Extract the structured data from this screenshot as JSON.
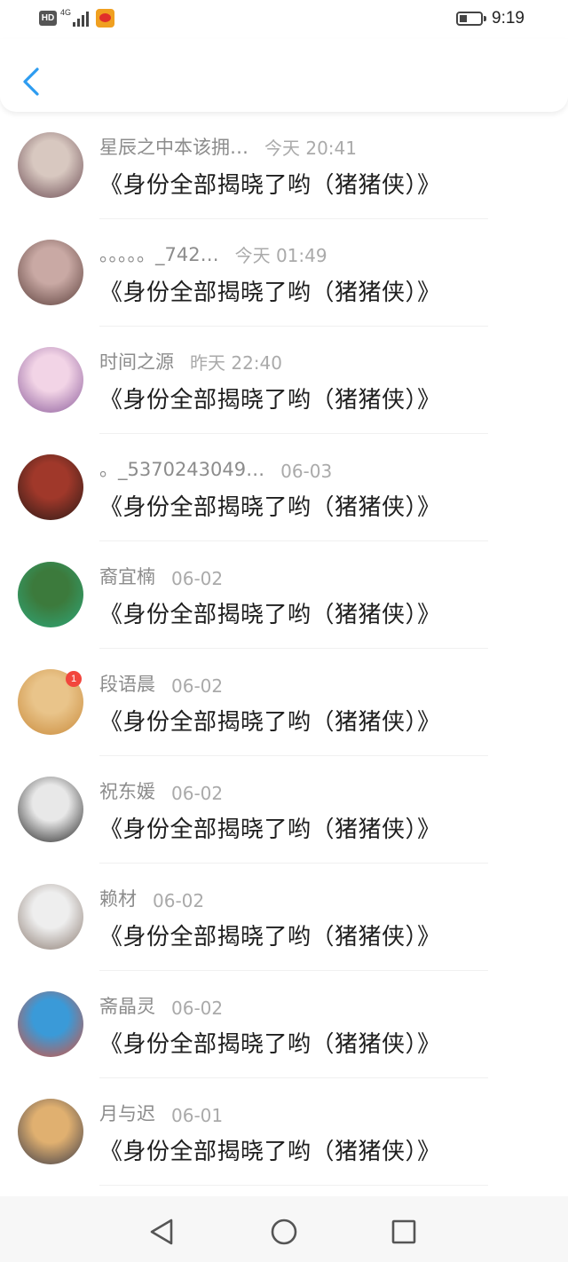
{
  "status_bar": {
    "hd": "HD",
    "network": "4G",
    "time": "9:19",
    "battery_level": 0.35
  },
  "header": {
    "back_icon": "chevron-left-icon",
    "accent": "#2d9cf0"
  },
  "items": [
    {
      "name": "星辰之中本该拥…",
      "time": "今天 20:41",
      "title": "《身份全部揭晓了哟（猪猪侠）》",
      "avatar_colors": [
        "#d8c8c0",
        "#6a4a52"
      ]
    },
    {
      "name": "。。。。。_742…",
      "time": "今天 01:49",
      "title": "《身份全部揭晓了哟（猪猪侠）》",
      "avatar_colors": [
        "#c9a9a4",
        "#5a3e3a"
      ]
    },
    {
      "name": "时间之源",
      "time": "昨天 22:40",
      "title": "《身份全部揭晓了哟（猪猪侠）》",
      "avatar_colors": [
        "#f2d4e6",
        "#8a5a9a"
      ]
    },
    {
      "name": "。_5370243049…",
      "time": "06-03",
      "title": "《身份全部揭晓了哟（猪猪侠）》",
      "avatar_colors": [
        "#a0382a",
        "#2a1a16"
      ]
    },
    {
      "name": "裔宜楠",
      "time": "06-02",
      "title": "《身份全部揭晓了哟（猪猪侠）》",
      "avatar_colors": [
        "#3c7a3c",
        "#2fa87a"
      ]
    },
    {
      "name": "段语晨",
      "time": "06-02",
      "title": "《身份全部揭晓了哟（猪猪侠）》",
      "avatar_colors": [
        "#e9c48a",
        "#c98a3a"
      ],
      "badge": "1"
    },
    {
      "name": "祝东媛",
      "time": "06-02",
      "title": "《身份全部揭晓了哟（猪猪侠）》",
      "avatar_colors": [
        "#e8e8e8",
        "#222222"
      ]
    },
    {
      "name": "赖材",
      "time": "06-02",
      "title": "《身份全部揭晓了哟（猪猪侠）》",
      "avatar_colors": [
        "#eeeeee",
        "#8a7a70"
      ]
    },
    {
      "name": "斋晶灵",
      "time": "06-02",
      "title": "《身份全部揭晓了哟（猪猪侠）》",
      "avatar_colors": [
        "#3a9ad8",
        "#d8503a"
      ]
    },
    {
      "name": "月与迟",
      "time": "06-01",
      "title": "《身份全部揭晓了哟（猪猪侠）》",
      "avatar_colors": [
        "#e0b070",
        "#3a3a48"
      ]
    }
  ],
  "nav": {
    "back_icon": "triangle-back-icon",
    "home_icon": "circle-home-icon",
    "recents_icon": "square-recents-icon"
  }
}
